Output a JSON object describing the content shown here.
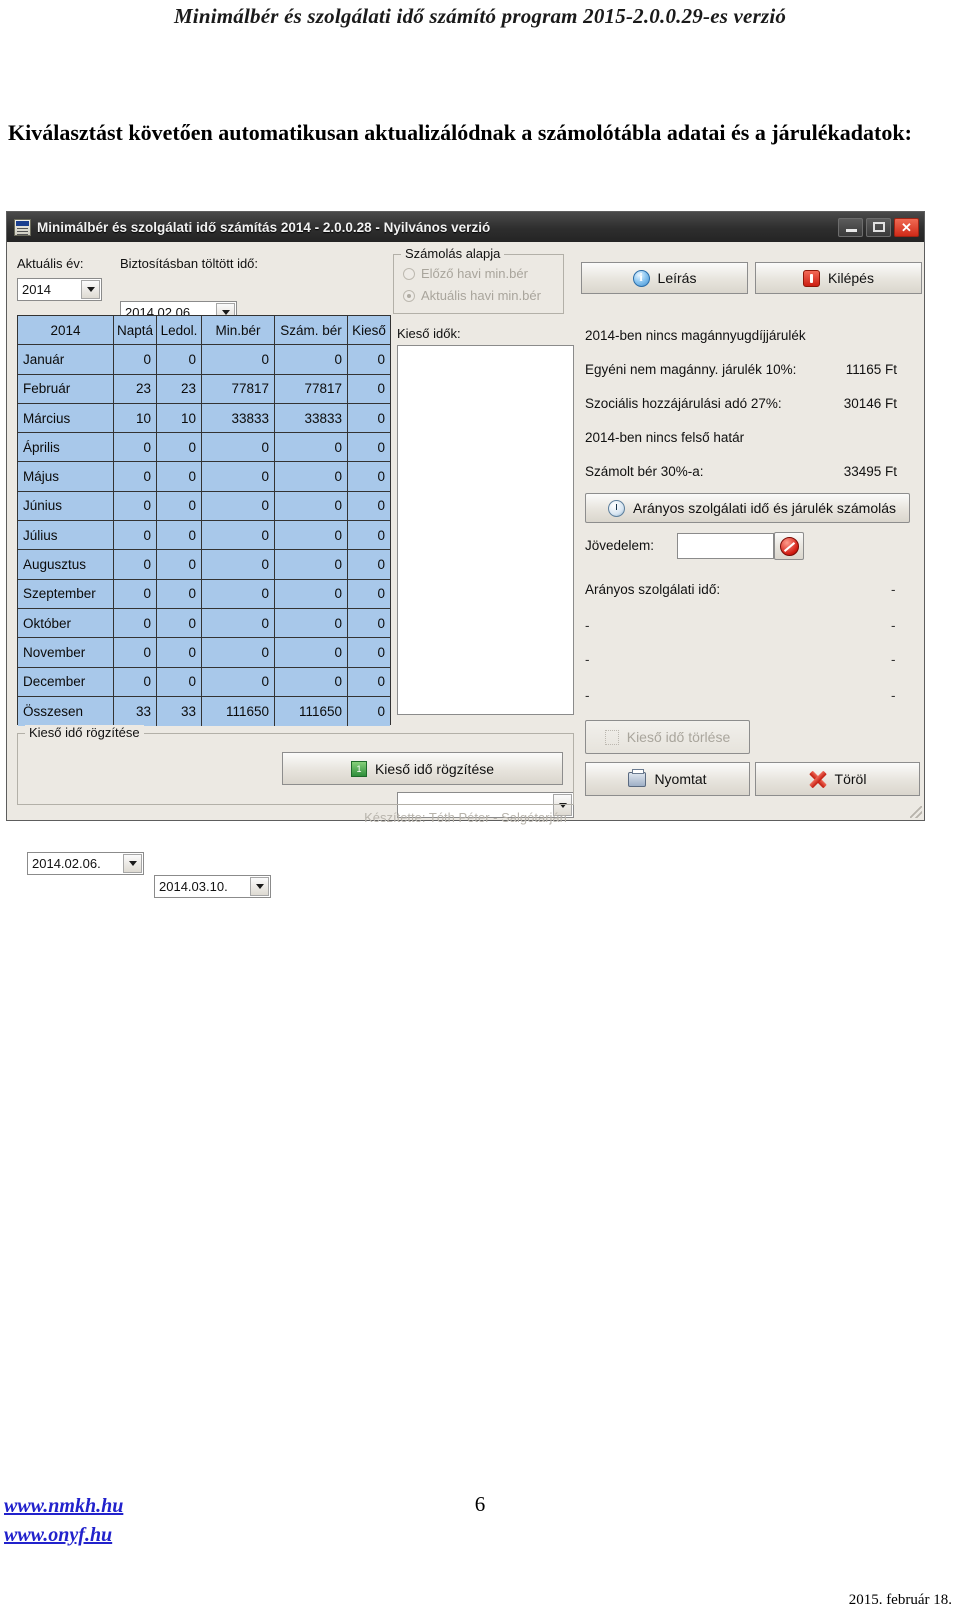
{
  "document": {
    "header": "Minimálbér és szolgálati idő számító program 2015-2.0.0.29-es verzió",
    "paragraph": "Kiválasztást követően automatikusan aktualizálódnak a számolótábla adatai és a járulékadatok:",
    "footer": {
      "link1": "www.nmkh.hu",
      "link2": "www.onyf.hu",
      "page_number": "6",
      "date": "2015. február 18."
    }
  },
  "window": {
    "title": "Minimálbér és szolgálati idő számítás 2014 - 2.0.0.28 - Nyilvános verzió",
    "controls": {
      "minimize": "minimize-icon",
      "maximize": "maximize-icon",
      "close": "✕"
    },
    "credits": "Készítette: Tóth Péter - Salgótarján"
  },
  "toolbar": {
    "current_year_label": "Aktuális év:",
    "current_year_value": "2014",
    "insured_time_label": "Biztosításban töltött idő:",
    "insured_from": "2014.02.06.",
    "insured_to": "2014.03.10.",
    "calc_basis": {
      "caption": "Számolás alapja",
      "option_previous": "Előző havi min.bér",
      "option_current": "Aktuális havi min.bér",
      "selected": "Aktuális havi min.bér"
    },
    "description_button": "Leírás",
    "exit_button": "Kilépés"
  },
  "table": {
    "headers": [
      "2014",
      "Naptá",
      "Ledol.",
      "Min.bér",
      "Szám. bér",
      "Kieső"
    ],
    "rows": [
      [
        "Január",
        "0",
        "0",
        "0",
        "0",
        "0"
      ],
      [
        "Február",
        "23",
        "23",
        "77817",
        "77817",
        "0"
      ],
      [
        "Március",
        "10",
        "10",
        "33833",
        "33833",
        "0"
      ],
      [
        "Április",
        "0",
        "0",
        "0",
        "0",
        "0"
      ],
      [
        "Május",
        "0",
        "0",
        "0",
        "0",
        "0"
      ],
      [
        "Június",
        "0",
        "0",
        "0",
        "0",
        "0"
      ],
      [
        "Július",
        "0",
        "0",
        "0",
        "0",
        "0"
      ],
      [
        "Augusztus",
        "0",
        "0",
        "0",
        "0",
        "0"
      ],
      [
        "Szeptember",
        "0",
        "0",
        "0",
        "0",
        "0"
      ],
      [
        "Október",
        "0",
        "0",
        "0",
        "0",
        "0"
      ],
      [
        "November",
        "0",
        "0",
        "0",
        "0",
        "0"
      ],
      [
        "December",
        "0",
        "0",
        "0",
        "0",
        "0"
      ],
      [
        "Összesen",
        "33",
        "33",
        "111650",
        "111650",
        "0"
      ]
    ]
  },
  "middle": {
    "lost_times_label": "Kieső idők:",
    "listbox_value": "",
    "dropdown_value": "",
    "delete_lost_time_button": "Kieső idő törlése"
  },
  "record_group": {
    "caption": "Kieső idő rögzítése",
    "from": "2014.02.06.",
    "to": "2014.03.10.",
    "button": "Kieső idő rögzítése"
  },
  "contributions": {
    "line1": "2014-ben nincs magánnyugdíjjárulék",
    "line2_label": "Egyéni nem magánny. járulék 10%:",
    "line2_value": "11165 Ft",
    "line3_label": "Szociális hozzájárulási adó 27%:",
    "line3_value": "30146 Ft",
    "line4": "2014-ben nincs felső határ",
    "line5_label": "Számolt bér 30%-a:",
    "line5_value": "33495 Ft",
    "proportional_button": "Arányos szolgálati idő és járulék számolás",
    "income_label": "Jövedelem:",
    "income_value": "",
    "proportional_label": "Arányos szolgálati idő:",
    "result_rows": [
      {
        "label": "",
        "value": "-"
      },
      {
        "label": "-",
        "value": "-"
      },
      {
        "label": "-",
        "value": "-"
      },
      {
        "label": "-",
        "value": "-"
      }
    ],
    "proportional_value": "-"
  },
  "actions": {
    "print_button": "Nyomtat",
    "delete_button": "Töröl"
  },
  "colors": {
    "grid_cell": "#a8c8ea",
    "titlebar": "#2e2e2e",
    "window_face": "#ece9e3",
    "link": "#2222cc"
  }
}
